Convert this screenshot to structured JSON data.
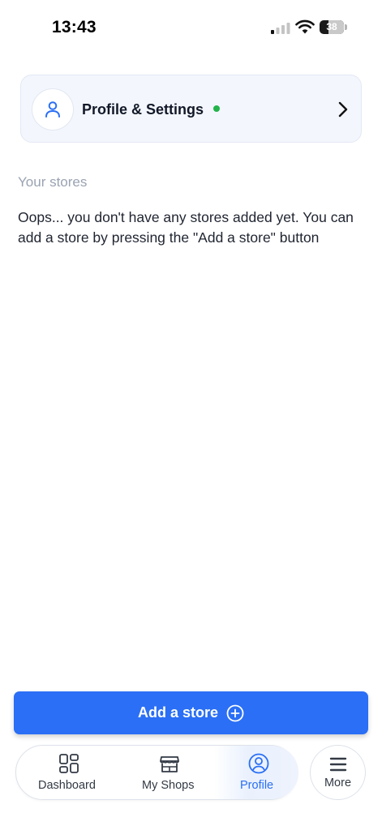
{
  "status_bar": {
    "time": "13:43",
    "battery_level": "38",
    "icons": [
      "signal-icon",
      "wifi-icon",
      "battery-icon"
    ]
  },
  "profile_card": {
    "title": "Profile & Settings",
    "icon": "user-icon",
    "status": "online",
    "chevron": "chevron-right-icon",
    "colors": {
      "status_dot": "#22b34a",
      "icon": "#2a6ff5"
    }
  },
  "stores": {
    "section_label": "Your stores",
    "empty_message": "Oops... you don't have any stores added yet. You can add a store by pressing the \"Add a store\" button"
  },
  "add_store_button": {
    "label": "Add a store",
    "icon": "plus-circle-icon",
    "color": "#2a6ff5"
  },
  "tab_bar": {
    "tabs": [
      {
        "label": "Dashboard",
        "icon": "dashboard-icon",
        "active": false
      },
      {
        "label": "My Shops",
        "icon": "shop-icon",
        "active": false
      },
      {
        "label": "Profile",
        "icon": "profile-icon",
        "active": true
      }
    ],
    "more": {
      "label": "More",
      "icon": "menu-icon"
    },
    "active_color": "#2a6ff5"
  }
}
